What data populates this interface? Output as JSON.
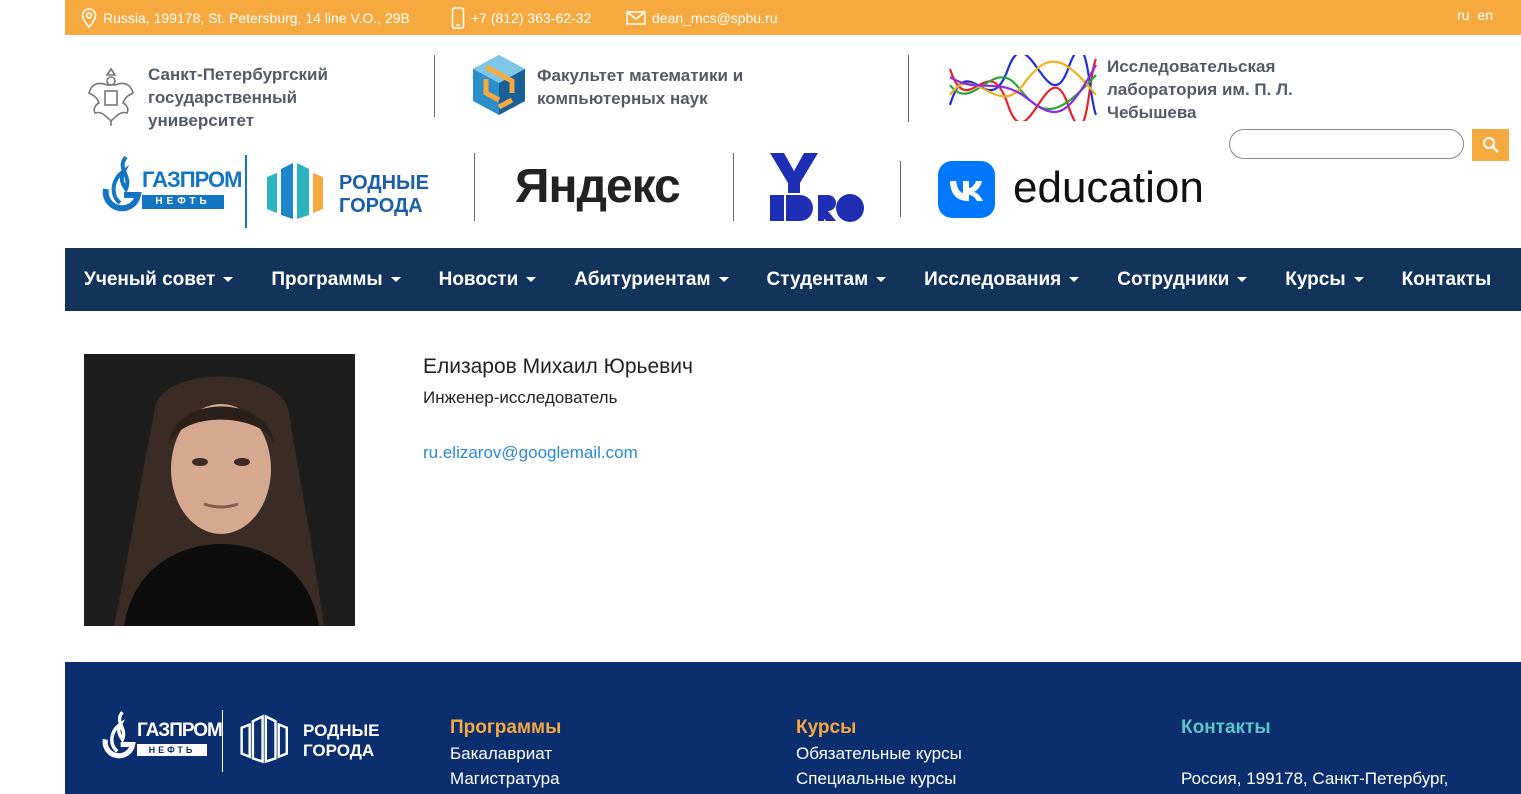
{
  "topbar": {
    "address": "Russia, 199178, St. Petersburg, 14 line V.O., 29B",
    "phone": "+7 (812) 363-62-32",
    "email": "dean_mcs@spbu.ru",
    "lang_ru": "ru",
    "lang_en": "en",
    "color": "#f5a93f"
  },
  "header": {
    "spbu": [
      "Санкт-Петербургский",
      "государственный",
      "университет"
    ],
    "faculty": [
      "Факультет математики и",
      "компьютерных наук"
    ],
    "lab": [
      "Исследовательская",
      "лаборатория им. П. Л.",
      "Чебышева"
    ]
  },
  "partners": {
    "gazprom_word": "ГАЗПРОМ",
    "gazprom_sub": "НЕФТЬ",
    "rodnye_1": "РОДНЫЕ",
    "rodnye_2": "ГОРОДА",
    "yandex": "Яндекс",
    "vk_education": "education"
  },
  "search": {
    "placeholder": ""
  },
  "nav": {
    "color": "#12335a",
    "items": [
      {
        "label": "Ученый совет",
        "dropdown": true
      },
      {
        "label": "Программы",
        "dropdown": true
      },
      {
        "label": "Новости",
        "dropdown": true
      },
      {
        "label": "Абитуриентам",
        "dropdown": true
      },
      {
        "label": "Студентам",
        "dropdown": true
      },
      {
        "label": "Исследования",
        "dropdown": true
      },
      {
        "label": "Сотрудники",
        "dropdown": true
      },
      {
        "label": "Курсы",
        "dropdown": true
      },
      {
        "label": "Контакты",
        "dropdown": false
      }
    ]
  },
  "profile": {
    "name": "Елизаров Михаил Юрьевич",
    "position": "Инженер-исследователь",
    "email": "ru.elizarov@googlemail.com"
  },
  "footer": {
    "color": "#0b2f6e",
    "programs": {
      "title": "Программы",
      "items": [
        "Бакалавриат",
        "Магистратура"
      ]
    },
    "courses": {
      "title": "Курсы",
      "items": [
        "Обязательные курсы",
        "Специальные курсы"
      ]
    },
    "contacts": {
      "title": "Контакты",
      "address": "Россия, 199178, Санкт-Петербург,"
    }
  }
}
